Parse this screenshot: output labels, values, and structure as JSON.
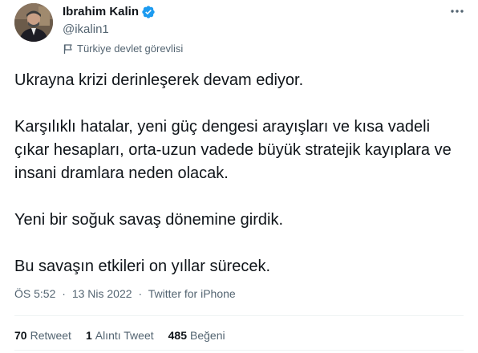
{
  "author": {
    "display_name": "Ibrahim Kalin",
    "handle": "@ikalin1",
    "verified": true,
    "account_label": "Türkiye devlet görevlisi",
    "avatar": "profile-photo"
  },
  "tweet": {
    "paragraphs": [
      "Ukrayna krizi derinleşerek devam ediyor.",
      "Karşılıklı hatalar, yeni güç dengesi arayışları ve kısa vadeli çıkar hesapları, orta-uzun vadede büyük stratejik kayıplara ve insani dramlara neden olacak.",
      "Yeni bir soğuk savaş dönemine girdik.",
      "Bu savaşın etkileri on yıllar sürecek."
    ],
    "time": "ÖS 5:52",
    "separator": "·",
    "date": "13 Nis 2022",
    "source": "Twitter for iPhone"
  },
  "stats": {
    "retweets": {
      "count": "70",
      "label": "Retweet"
    },
    "quotes": {
      "count": "1",
      "label": "Alıntı Tweet"
    },
    "likes": {
      "count": "485",
      "label": "Beğeni"
    }
  },
  "icons": {
    "verified": "verified-badge-icon",
    "label": "government-flag-icon",
    "menu": "more-options-icon"
  },
  "colors": {
    "verified_blue": "#1d9bf0",
    "secondary_text": "#536471",
    "primary_text": "#0f1419",
    "divider": "#eff3f4"
  }
}
